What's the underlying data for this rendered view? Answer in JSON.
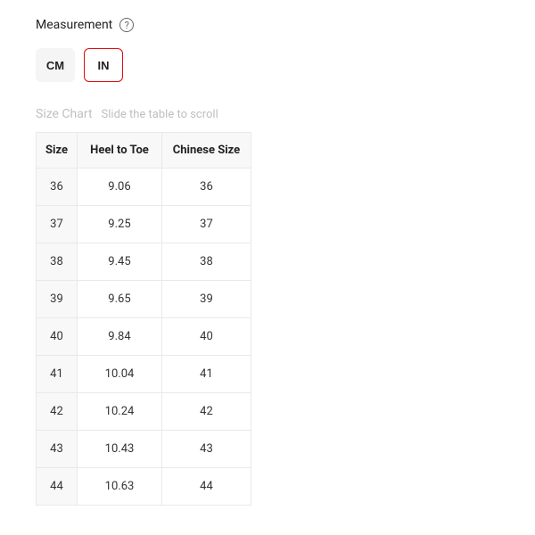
{
  "measurement": {
    "label": "Measurement",
    "help": "?"
  },
  "units": {
    "cm": "CM",
    "in": "IN"
  },
  "chart": {
    "title": "Size Chart",
    "hint": "Slide the table to scroll",
    "headers": {
      "size": "Size",
      "heel_to_toe": "Heel to Toe",
      "chinese_size": "Chinese Size"
    },
    "rows": [
      {
        "size": "36",
        "heel_to_toe": "9.06",
        "chinese_size": "36"
      },
      {
        "size": "37",
        "heel_to_toe": "9.25",
        "chinese_size": "37"
      },
      {
        "size": "38",
        "heel_to_toe": "9.45",
        "chinese_size": "38"
      },
      {
        "size": "39",
        "heel_to_toe": "9.65",
        "chinese_size": "39"
      },
      {
        "size": "40",
        "heel_to_toe": "9.84",
        "chinese_size": "40"
      },
      {
        "size": "41",
        "heel_to_toe": "10.04",
        "chinese_size": "41"
      },
      {
        "size": "42",
        "heel_to_toe": "10.24",
        "chinese_size": "42"
      },
      {
        "size": "43",
        "heel_to_toe": "10.43",
        "chinese_size": "43"
      },
      {
        "size": "44",
        "heel_to_toe": "10.63",
        "chinese_size": "44"
      }
    ]
  }
}
